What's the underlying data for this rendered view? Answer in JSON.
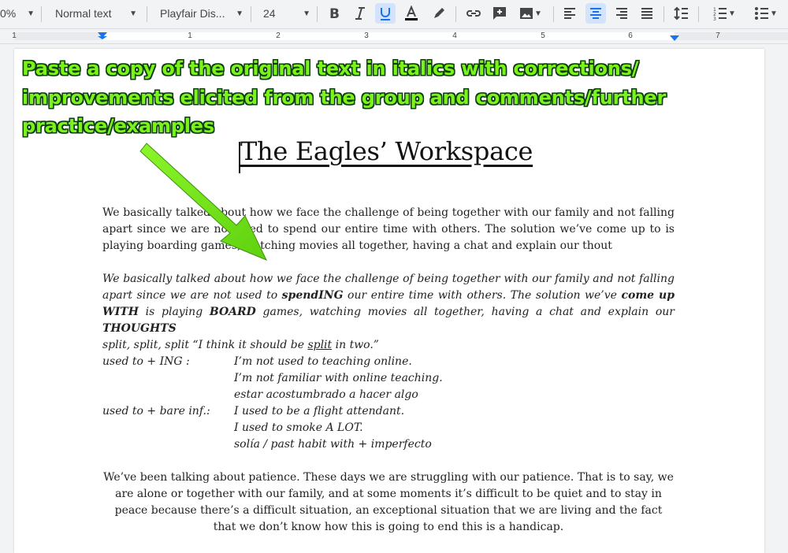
{
  "toolbar": {
    "zoom": "0%",
    "style": "Normal text",
    "font": "Playfair Dis...",
    "size": "24",
    "colors": {
      "active_bg": "#d3e3fd",
      "accent": "#1a73e8"
    }
  },
  "ruler": {
    "numbers": [
      "1",
      "1",
      "2",
      "3",
      "4",
      "5",
      "6",
      "7"
    ]
  },
  "annotation": {
    "lines": [
      "Paste a copy of the original text in italics with corrections/",
      "improvements elicited from the group and comments/further",
      "practice/examples"
    ],
    "color": "#7cf21b"
  },
  "document": {
    "title": "The Eagles’ Workspace",
    "para1": "We basically talked about how we face the challenge of being together with our family and not falling apart since we are not used to spend our entire time with others. The solution we’ve come up to is playing boarding games, watching movies all together, having a chat and explain our thout",
    "para2": {
      "a": "We basically talked about how we face the challenge of being together with our family and not falling apart since we are not used to ",
      "b": "spendING",
      "c": " our entire time with others. The solution we’ve ",
      "d": "come up WITH",
      "e": " is playing ",
      "f": "BOARD",
      "g": " games, watching movies all together, having a chat and explain our ",
      "h": "THOUGHTS"
    },
    "split_line": {
      "a": "split, split, split “I think it should be ",
      "b": "split",
      "c": " in two.”"
    },
    "used_to_ing": {
      "label": "used to + ING :",
      "lines": [
        "I’m not used to teaching online.",
        "I’m not familiar with online teaching.",
        "estar acostumbrado a hacer algo"
      ]
    },
    "used_to_bare": {
      "label": "used to + bare inf.:",
      "lines": [
        "I used to be a flight attendant.",
        "I used to smoke A LOT.",
        "solía / past habit with + imperfecto"
      ]
    },
    "para3": "We’ve been talking about patience. These days we are struggling with our patience. That is to say, we are alone or together with our family, and at some moments it’s difficult to be quiet and to stay in peace because there’s a difficult situation, an exceptional situation that we are living and the fact that we don’t know how this is going to end this is a handicap."
  }
}
